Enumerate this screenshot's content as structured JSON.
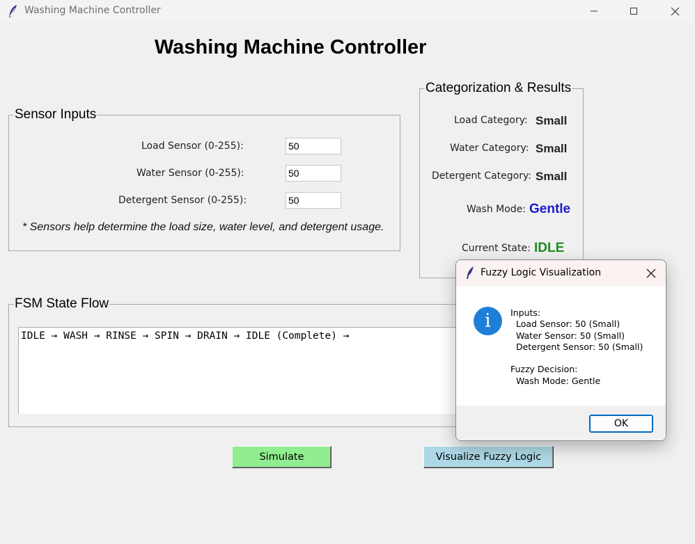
{
  "window": {
    "title": "Washing Machine Controller",
    "icons": {
      "app": "feather-icon",
      "minimize": "minimize-icon",
      "maximize": "maximize-icon",
      "close": "close-icon"
    }
  },
  "main_title": "Washing Machine Controller",
  "sensor_inputs": {
    "legend": "Sensor Inputs",
    "fields": [
      {
        "label": "Load Sensor (0-255):",
        "value": "50"
      },
      {
        "label": "Water Sensor (0-255):",
        "value": "50"
      },
      {
        "label": "Detergent Sensor (0-255):",
        "value": "50"
      }
    ],
    "note": "* Sensors help determine the load size, water level, and detergent usage."
  },
  "results": {
    "legend": "Categorization & Results",
    "load_label": "Load Category:",
    "load_value": "Small",
    "water_label": "Water Category:",
    "water_value": "Small",
    "detergent_label": "Detergent Category:",
    "detergent_value": "Small",
    "mode_label": "Wash Mode:",
    "mode_value": "Gentle",
    "state_label": "Current State:",
    "state_value": "IDLE",
    "colors": {
      "mode": "#1a1acc",
      "state": "#1e8a1e"
    }
  },
  "fsm": {
    "legend": "FSM State Flow",
    "flow_text": "IDLE → WASH → RINSE → SPIN → DRAIN → IDLE (Complete) →"
  },
  "buttons": {
    "simulate": "Simulate",
    "visualize": "Visualize Fuzzy Logic",
    "colors": {
      "simulate": "#90ee90",
      "visualize": "#add8e6"
    }
  },
  "dialog": {
    "title": "Fuzzy Logic Visualization",
    "icon": "info-icon",
    "message": "Inputs:\n  Load Sensor: 50 (Small)\n  Water Sensor: 50 (Small)\n  Detergent Sensor: 50 (Small)\n\nFuzzy Decision:\n  Wash Mode: Gentle",
    "ok": "OK"
  }
}
